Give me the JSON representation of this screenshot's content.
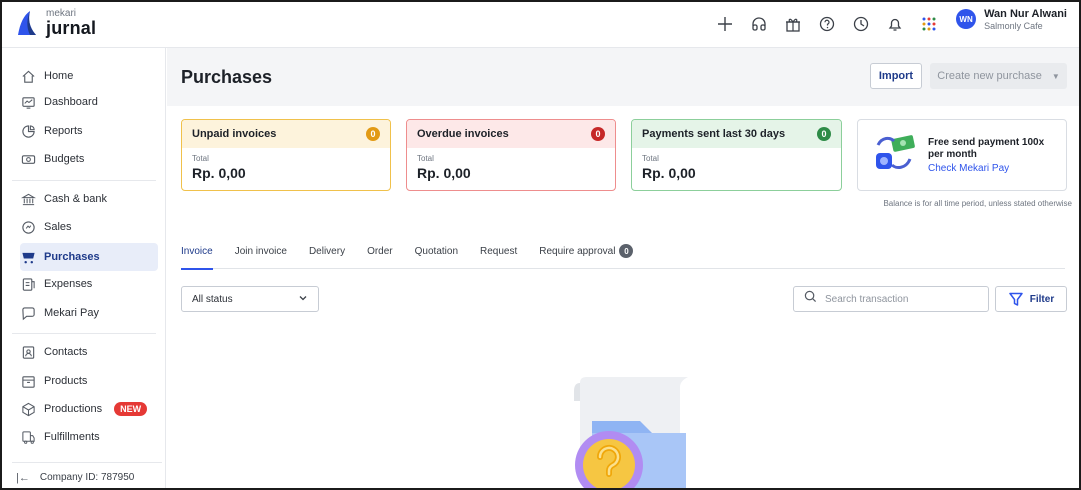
{
  "brand": {
    "small": "mekari",
    "big": "jurnal",
    "accent": "#2f54eb"
  },
  "topbar": {
    "icons": [
      "plus-icon",
      "headset-icon",
      "gift-icon",
      "help-icon",
      "history-icon",
      "bell-icon",
      "apps-grid-icon"
    ],
    "user": {
      "initials": "WN",
      "name": "Wan Nur Alwani",
      "company": "Salmonly Cafe"
    }
  },
  "sidebar": {
    "items": [
      {
        "label": "Home",
        "icon": "home-icon"
      },
      {
        "label": "Dashboard",
        "icon": "dashboard-icon"
      },
      {
        "label": "Reports",
        "icon": "reports-icon"
      },
      {
        "label": "Budgets",
        "icon": "budgets-icon"
      },
      {
        "label": "Cash & bank",
        "icon": "bank-icon"
      },
      {
        "label": "Sales",
        "icon": "sales-icon"
      },
      {
        "label": "Purchases",
        "icon": "purchases-icon",
        "active": true
      },
      {
        "label": "Expenses",
        "icon": "expenses-icon"
      },
      {
        "label": "Mekari Pay",
        "icon": "chat-icon"
      },
      {
        "label": "Contacts",
        "icon": "contacts-icon"
      },
      {
        "label": "Products",
        "icon": "products-icon"
      },
      {
        "label": "Productions",
        "icon": "productions-icon",
        "badge": "NEW"
      },
      {
        "label": "Fulfillments",
        "icon": "fulfillments-icon"
      }
    ],
    "company_id": "Company ID: 787950"
  },
  "page": {
    "title": "Purchases",
    "import_label": "Import",
    "create_label": "Create new purchase"
  },
  "cards": {
    "unpaid": {
      "title": "Unpaid invoices",
      "count": "0",
      "label": "Total",
      "value": "Rp. 0,00"
    },
    "overdue": {
      "title": "Overdue invoices",
      "count": "0",
      "label": "Total",
      "value": "Rp. 0,00"
    },
    "paid": {
      "title": "Payments sent last 30 days",
      "count": "0",
      "label": "Total",
      "value": "Rp. 0,00"
    }
  },
  "promo": {
    "title": "Free send payment 100x per month",
    "link": "Check Mekari Pay"
  },
  "balance_note": "Balance is for all time period, unless stated otherwise",
  "tabs": [
    {
      "label": "Invoice",
      "active": true
    },
    {
      "label": "Join invoice"
    },
    {
      "label": "Delivery"
    },
    {
      "label": "Order"
    },
    {
      "label": "Quotation"
    },
    {
      "label": "Request"
    },
    {
      "label": "Require approval",
      "count": "0"
    }
  ],
  "filters": {
    "status_value": "All status",
    "search_placeholder": "Search transaction",
    "filter_label": "Filter"
  }
}
